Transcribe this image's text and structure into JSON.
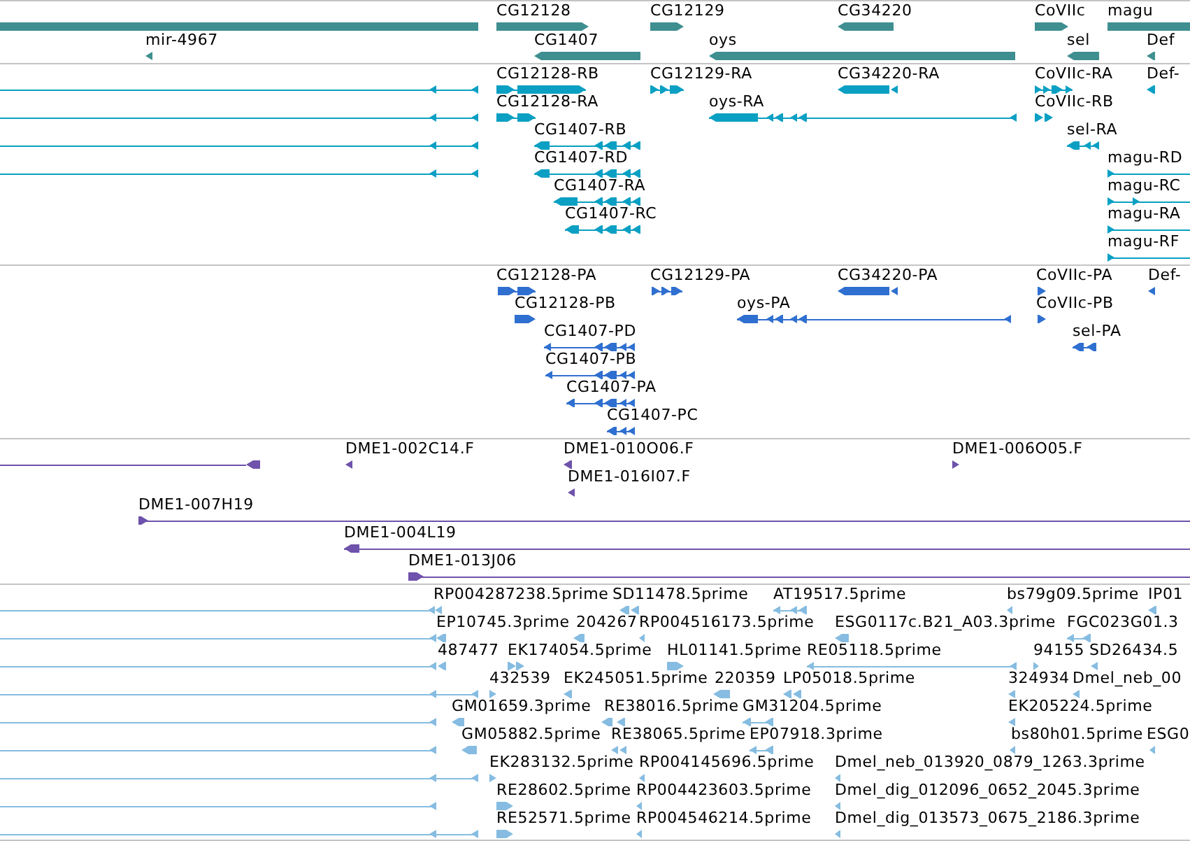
{
  "tracks": [
    {
      "kind": "gene",
      "rows": [
        {
          "features": [
            {
              "reverse_strand": true
            },
            {
              "label": "CG12128",
              "reverse_strand": false
            },
            {
              "label": "CG12129",
              "reverse_strand": false
            },
            {
              "label": "CG34220",
              "reverse_strand": true
            },
            {
              "label": "CoVIIc",
              "reverse_strand": false
            },
            {
              "label": "magu",
              "reverse_strand": false
            }
          ]
        },
        {
          "features": [
            {
              "label": "mir-4967",
              "reverse_strand": true
            },
            {
              "label": "CG1407",
              "reverse_strand": true
            },
            {
              "label": "oys",
              "reverse_strand": true
            },
            {
              "label": "sel",
              "reverse_strand": true
            },
            {
              "label": "Def",
              "reverse_strand": true
            }
          ]
        }
      ]
    },
    {
      "kind": "transcript",
      "rows": [
        {
          "features": [
            {
              "reverse_strand": true
            },
            {
              "label": "CG12128-RB",
              "reverse_strand": false
            },
            {
              "label": "CG12129-RA",
              "reverse_strand": false
            },
            {
              "label": "CG34220-RA",
              "reverse_strand": true
            },
            {
              "label": "CoVIIc-RA",
              "reverse_strand": false
            },
            {
              "label": "Def-",
              "reverse_strand": true
            }
          ]
        },
        {
          "features": [
            {
              "reverse_strand": true
            },
            {
              "label": "CG12128-RA",
              "reverse_strand": false
            },
            {
              "label": "oys-RA",
              "reverse_strand": true
            },
            {
              "label": "CoVIIc-RB",
              "reverse_strand": false
            }
          ]
        },
        {
          "features": [
            {
              "reverse_strand": true
            },
            {
              "label": "CG1407-RB",
              "reverse_strand": true
            },
            {
              "label": "sel-RA",
              "reverse_strand": true
            }
          ]
        },
        {
          "features": [
            {
              "reverse_strand": true
            },
            {
              "label": "CG1407-RD",
              "reverse_strand": true
            },
            {
              "label": "magu-RD",
              "reverse_strand": false
            }
          ]
        },
        {
          "features": [
            {
              "label": "CG1407-RA",
              "reverse_strand": true
            },
            {
              "label": "magu-RC",
              "reverse_strand": false
            }
          ]
        },
        {
          "features": [
            {
              "label": "CG1407-RC",
              "reverse_strand": true
            },
            {
              "label": "magu-RA",
              "reverse_strand": false
            }
          ]
        },
        {
          "features": [
            {
              "label": "magu-RF",
              "reverse_strand": false
            }
          ]
        }
      ]
    },
    {
      "kind": "protein",
      "rows": [
        {
          "features": [
            {
              "label": "CG12128-PA",
              "reverse_strand": false
            },
            {
              "label": "CG12129-PA",
              "reverse_strand": false
            },
            {
              "label": "CG34220-PA",
              "reverse_strand": true
            },
            {
              "label": "CoVIIc-PA",
              "reverse_strand": false
            },
            {
              "label": "Def-",
              "reverse_strand": true
            }
          ]
        },
        {
          "features": [
            {
              "label": "CG12128-PB",
              "reverse_strand": false
            },
            {
              "label": "oys-PA",
              "reverse_strand": true
            },
            {
              "label": "CoVIIc-PB",
              "reverse_strand": false
            }
          ]
        },
        {
          "features": [
            {
              "label": "CG1407-PD",
              "reverse_strand": true
            },
            {
              "label": "sel-PA",
              "reverse_strand": true
            }
          ]
        },
        {
          "features": [
            {
              "label": "CG1407-PB",
              "reverse_strand": true
            }
          ]
        },
        {
          "features": [
            {
              "label": "CG1407-PA",
              "reverse_strand": true
            }
          ]
        },
        {
          "features": [
            {
              "label": "CG1407-PC",
              "reverse_strand": true
            }
          ]
        }
      ]
    },
    {
      "kind": "clone",
      "rows": [
        {
          "features": [
            {
              "reverse_strand": true
            },
            {
              "label": "DME1-002C14.F",
              "reverse_strand": true
            },
            {
              "label": "DME1-010O06.F",
              "reverse_strand": true
            },
            {
              "label": "DME1-006O05.F",
              "reverse_strand": false
            }
          ]
        },
        {
          "features": [
            {
              "label": "DME1-016I07.F",
              "reverse_strand": true
            }
          ]
        },
        {
          "features": [
            {
              "label": "DME1-007H19",
              "reverse_strand": false
            }
          ]
        },
        {
          "features": [
            {
              "label": "DME1-004L19",
              "reverse_strand": true
            }
          ]
        },
        {
          "features": [
            {
              "label": "DME1-013J06",
              "reverse_strand": false
            }
          ]
        }
      ]
    },
    {
      "kind": "est",
      "rows": [
        {
          "features": [
            {
              "reverse_strand": true
            },
            {
              "label": "RP004287238.5prime",
              "reverse_strand": true
            },
            {
              "label": "SD11478.5prime",
              "reverse_strand": true
            },
            {
              "label": "AT19517.5prime",
              "reverse_strand": true
            },
            {
              "label": "bs79g09.5prime",
              "reverse_strand": true
            },
            {
              "label": "IP01",
              "reverse_strand": true
            }
          ]
        },
        {
          "features": [
            {
              "reverse_strand": true
            },
            {
              "label": "EP10745.3prime",
              "reverse_strand": true
            },
            {
              "label": "204267",
              "reverse_strand": true
            },
            {
              "label": "RP004516173.5prime",
              "reverse_strand": true
            },
            {
              "label": "ESG0117c.B21_A03.3prime",
              "reverse_strand": true
            },
            {
              "label": "FGC023G01.3",
              "reverse_strand": true
            }
          ]
        },
        {
          "features": [
            {
              "reverse_strand": true
            },
            {
              "label": "487477",
              "reverse_strand": true
            },
            {
              "label": "EK174054.5prime",
              "reverse_strand": false
            },
            {
              "label": "HL01141.5prime",
              "reverse_strand": false
            },
            {
              "label": "RE05118.5prime",
              "reverse_strand": true
            },
            {
              "label": "94155",
              "reverse_strand": false
            },
            {
              "label": "SD26434.5",
              "reverse_strand": true
            }
          ]
        },
        {
          "features": [
            {
              "reverse_strand": true
            },
            {
              "label": "432539",
              "reverse_strand": false
            },
            {
              "label": "EK245051.5prime",
              "reverse_strand": true
            },
            {
              "label": "220359",
              "reverse_strand": true
            },
            {
              "label": "LP05018.5prime",
              "reverse_strand": true
            },
            {
              "label": "324934",
              "reverse_strand": true
            },
            {
              "label": "Dmel_neb_00",
              "reverse_strand": true
            }
          ]
        },
        {
          "features": [
            {
              "reverse_strand": true
            },
            {
              "label": "GM01659.3prime",
              "reverse_strand": true
            },
            {
              "label": "RE38016.5prime",
              "reverse_strand": true
            },
            {
              "label": "GM31204.5prime",
              "reverse_strand": true
            },
            {
              "label": "EK205224.5prime",
              "reverse_strand": true
            }
          ]
        },
        {
          "features": [
            {
              "reverse_strand": true
            },
            {
              "label": "GM05882.5prime",
              "reverse_strand": true
            },
            {
              "label": "RE38065.5prime",
              "reverse_strand": true
            },
            {
              "label": "EP07918.3prime",
              "reverse_strand": true
            },
            {
              "label": "bs80h01.5prime",
              "reverse_strand": true
            },
            {
              "label": "ESG0",
              "reverse_strand": true
            }
          ]
        },
        {
          "features": [
            {
              "reverse_strand": true
            },
            {
              "label": "EK283132.5prime",
              "reverse_strand": false
            },
            {
              "label": "RP004145696.5prime",
              "reverse_strand": true
            },
            {
              "label": "Dmel_neb_013920_0879_1263.3prime",
              "reverse_strand": true
            }
          ]
        },
        {
          "features": [
            {
              "reverse_strand": true
            },
            {
              "label": "RE28602.5prime",
              "reverse_strand": false
            },
            {
              "label": "RP004423603.5prime",
              "reverse_strand": true
            },
            {
              "label": "Dmel_dig_012096_0652_2045.3prime",
              "reverse_strand": true
            }
          ]
        },
        {
          "features": [
            {
              "reverse_strand": true
            },
            {
              "label": "RE52571.5prime",
              "reverse_strand": false
            },
            {
              "label": "RP004546214.5prime",
              "reverse_strand": true
            },
            {
              "label": "Dmel_dig_013573_0675_2186.3prime",
              "reverse_strand": true
            }
          ]
        }
      ]
    }
  ]
}
